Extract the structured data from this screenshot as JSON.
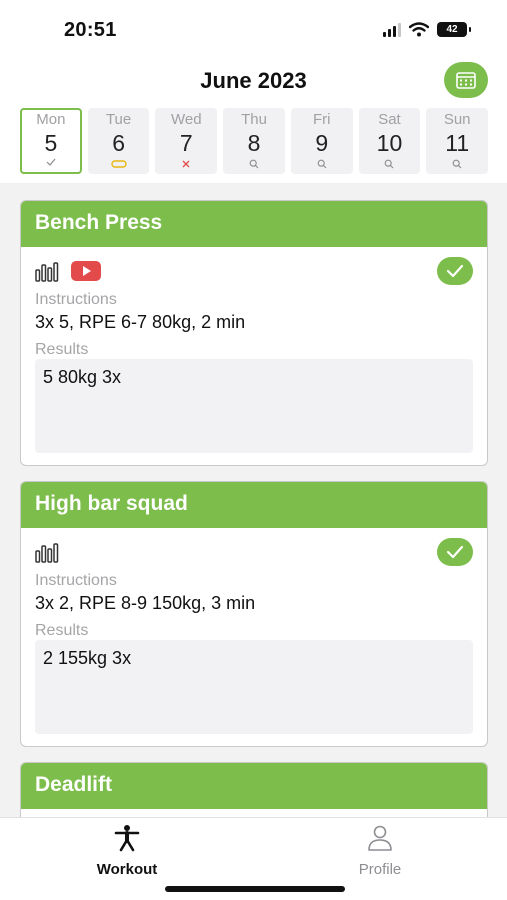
{
  "status_bar": {
    "time": "20:51",
    "battery": "42"
  },
  "header": {
    "title": "June 2023"
  },
  "week": [
    {
      "name": "Mon",
      "num": "5",
      "mark": "check",
      "selected": true
    },
    {
      "name": "Tue",
      "num": "6",
      "mark": "pill",
      "selected": false
    },
    {
      "name": "Wed",
      "num": "7",
      "mark": "cross",
      "selected": false
    },
    {
      "name": "Thu",
      "num": "8",
      "mark": "search",
      "selected": false
    },
    {
      "name": "Fri",
      "num": "9",
      "mark": "search",
      "selected": false
    },
    {
      "name": "Sat",
      "num": "10",
      "mark": "search",
      "selected": false
    },
    {
      "name": "Sun",
      "num": "11",
      "mark": "search",
      "selected": false
    }
  ],
  "cards": [
    {
      "title": "Bench Press",
      "has_video": true,
      "instructions_label": "Instructions",
      "instructions": "3x 5, RPE 6-7 80kg, 2 min",
      "results_label": "Results",
      "results": "5 80kg 3x"
    },
    {
      "title": "High bar squad",
      "has_video": false,
      "instructions_label": "Instructions",
      "instructions": "3x 2, RPE 8-9 150kg, 3 min",
      "results_label": "Results",
      "results": "2 155kg 3x"
    },
    {
      "title": "Deadlift"
    }
  ],
  "tabs": [
    {
      "label": "Workout",
      "icon": "person-icon",
      "active": true
    },
    {
      "label": "Profile",
      "icon": "profile-icon",
      "active": false
    }
  ],
  "colors": {
    "accent": "#7cbd4b",
    "youtube": "#e34b4b",
    "pill": "#e8b80f",
    "cross": "#e34b4b",
    "muted": "#a5a5a8"
  }
}
